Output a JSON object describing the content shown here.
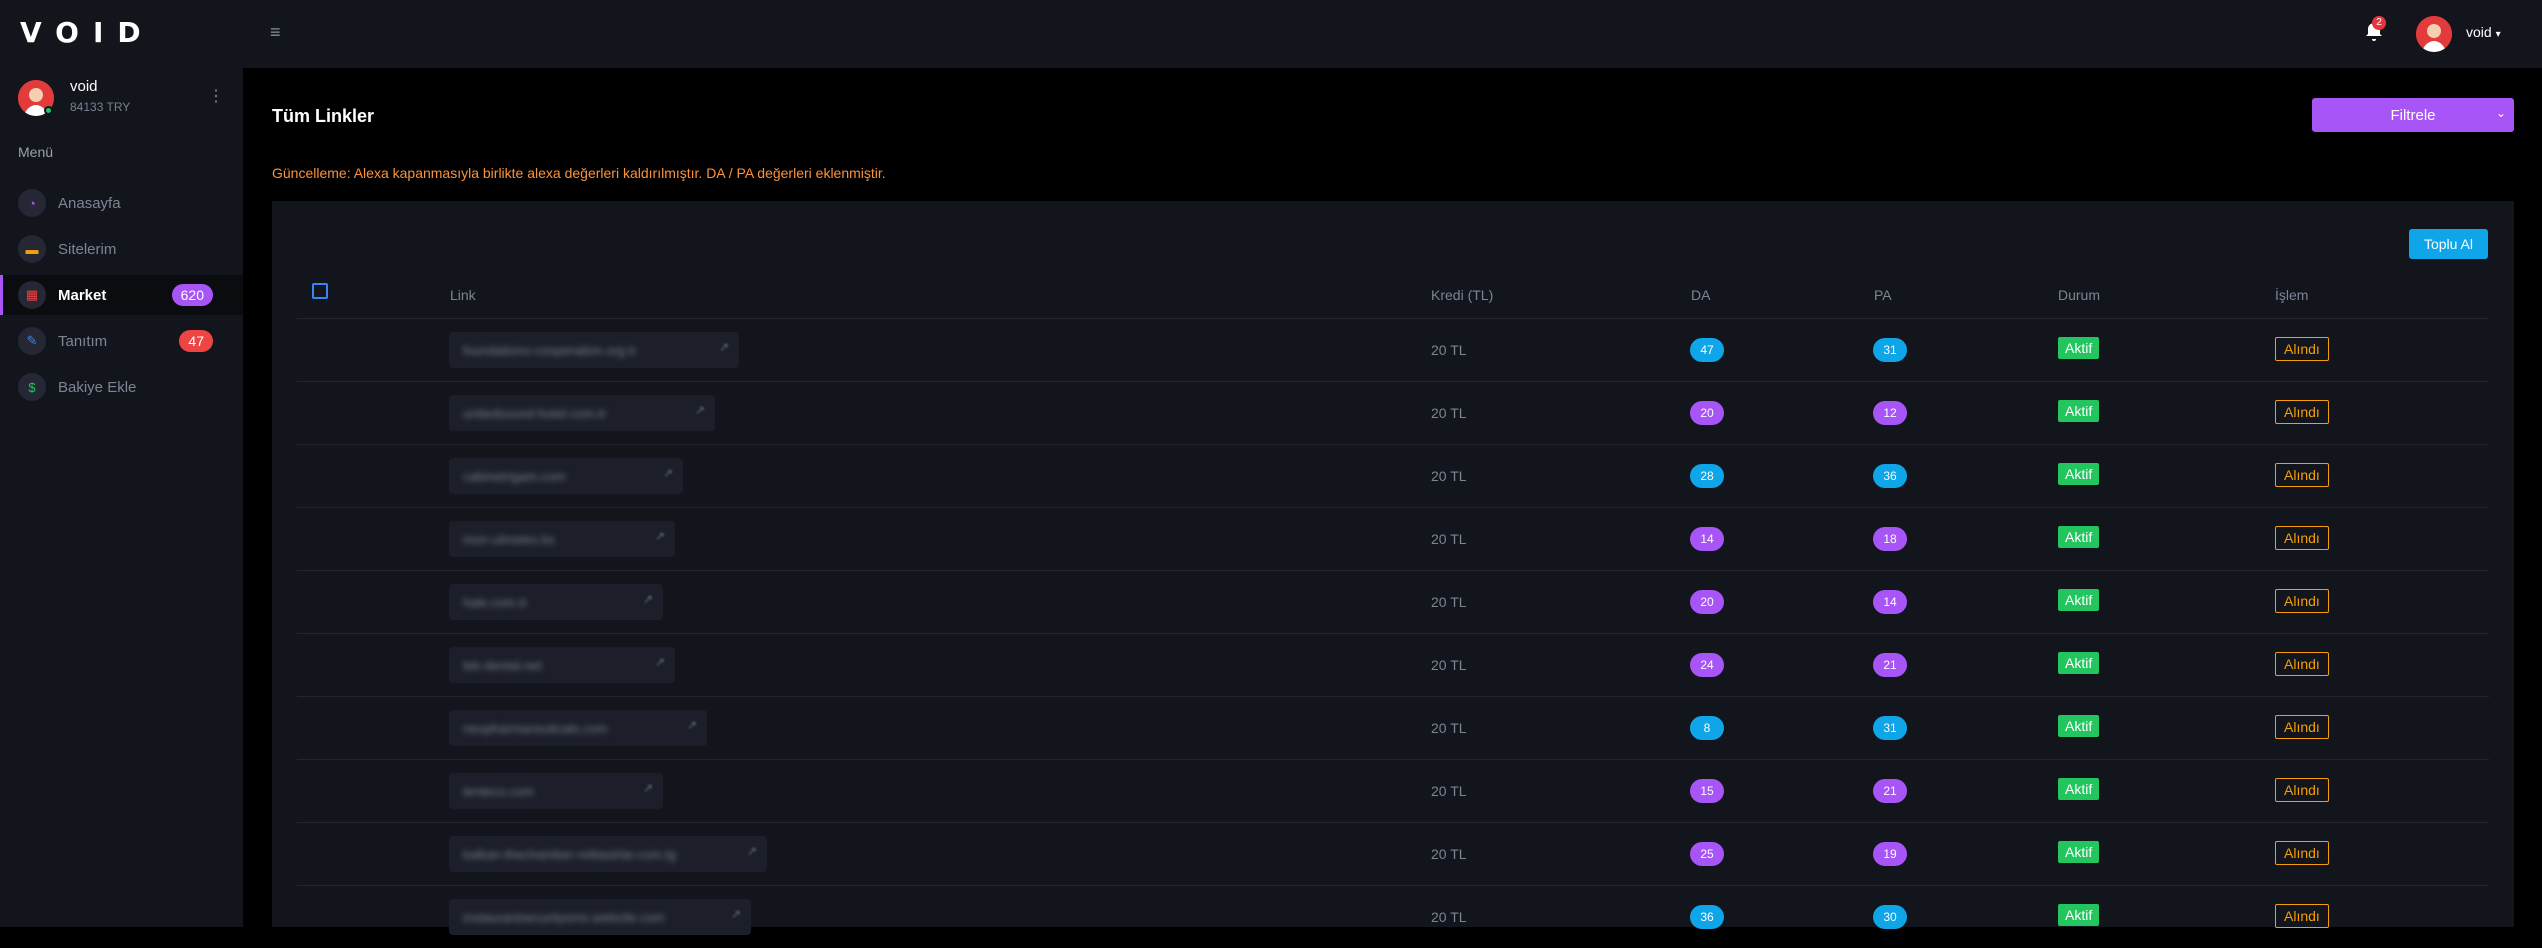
{
  "app": {
    "logo": "VOID",
    "menu_icon": "hamburger-icon"
  },
  "topbar": {
    "notifications": "2",
    "username": "void"
  },
  "sidebar": {
    "user_name": "void",
    "balance": "84133 TRY",
    "menu_title": "Menü",
    "items": [
      {
        "label": "Anasayfa",
        "icon": "dashboard-icon",
        "badge": ""
      },
      {
        "label": "Sitelerim",
        "icon": "sites-icon",
        "badge": ""
      },
      {
        "label": "Market",
        "icon": "market-icon",
        "badge": "620",
        "active": true
      },
      {
        "label": "Tanıtım",
        "icon": "promo-icon",
        "badge": "47"
      },
      {
        "label": "Bakiye Ekle",
        "icon": "wallet-icon",
        "badge": ""
      }
    ]
  },
  "main": {
    "title": "Tüm Linkler",
    "filter_label": "Filtrele",
    "notice": "Güncelleme: Alexa kapanmasıyla birlikte alexa değerleri kaldırılmıştır. DA / PA değerleri eklenmiştir.",
    "bulk_button": "Toplu Al"
  },
  "table": {
    "columns": [
      "Link",
      "Kredi (TL)",
      "DA",
      "PA",
      "Durum",
      "İşlem"
    ],
    "rows": [
      {
        "link": "foundations-cooperation.org.tr",
        "credit": "20 TL",
        "da": "47",
        "pa": "31",
        "da_color": "#0ea5e9",
        "pa_color": "#0ea5e9",
        "status": "Aktif",
        "action": "Alındı"
      },
      {
        "link": "unitedsound-hotel.com.tr",
        "credit": "20 TL",
        "da": "20",
        "pa": "12",
        "da_color": "#a855f7",
        "pa_color": "#a855f7",
        "status": "Aktif",
        "action": "Alındı"
      },
      {
        "link": "cabinetrigam.com",
        "credit": "20 TL",
        "da": "28",
        "pa": "36",
        "da_color": "#0ea5e9",
        "pa_color": "#0ea5e9",
        "status": "Aktif",
        "action": "Alındı"
      },
      {
        "link": "mon-ulmetex.ks",
        "credit": "20 TL",
        "da": "14",
        "pa": "18",
        "da_color": "#a855f7",
        "pa_color": "#a855f7",
        "status": "Aktif",
        "action": "Alındı"
      },
      {
        "link": "hale.com.tr",
        "credit": "20 TL",
        "da": "20",
        "pa": "14",
        "da_color": "#a855f7",
        "pa_color": "#a855f7",
        "status": "Aktif",
        "action": "Alındı"
      },
      {
        "link": "tek-dental.net",
        "credit": "20 TL",
        "da": "24",
        "pa": "21",
        "da_color": "#a855f7",
        "pa_color": "#a855f7",
        "status": "Aktif",
        "action": "Alındı"
      },
      {
        "link": "neopharmaceuticals.com",
        "credit": "20 TL",
        "da": "8",
        "pa": "31",
        "da_color": "#0ea5e9",
        "pa_color": "#0ea5e9",
        "status": "Aktif",
        "action": "Alındı"
      },
      {
        "link": "tenteco.com",
        "credit": "20 TL",
        "da": "15",
        "pa": "21",
        "da_color": "#a855f7",
        "pa_color": "#a855f7",
        "status": "Aktif",
        "action": "Alındı"
      },
      {
        "link": "kalkan-thechamber-relitasirlar.com.tg",
        "credit": "20 TL",
        "da": "25",
        "pa": "19",
        "da_color": "#a855f7",
        "pa_color": "#a855f7",
        "status": "Aktif",
        "action": "Alındı"
      },
      {
        "link": "instaurantsecuritysms.webcite.com",
        "credit": "20 TL",
        "da": "36",
        "pa": "30",
        "da_color": "#0ea5e9",
        "pa_color": "#0ea5e9",
        "status": "Aktif",
        "action": "Alındı"
      }
    ]
  }
}
